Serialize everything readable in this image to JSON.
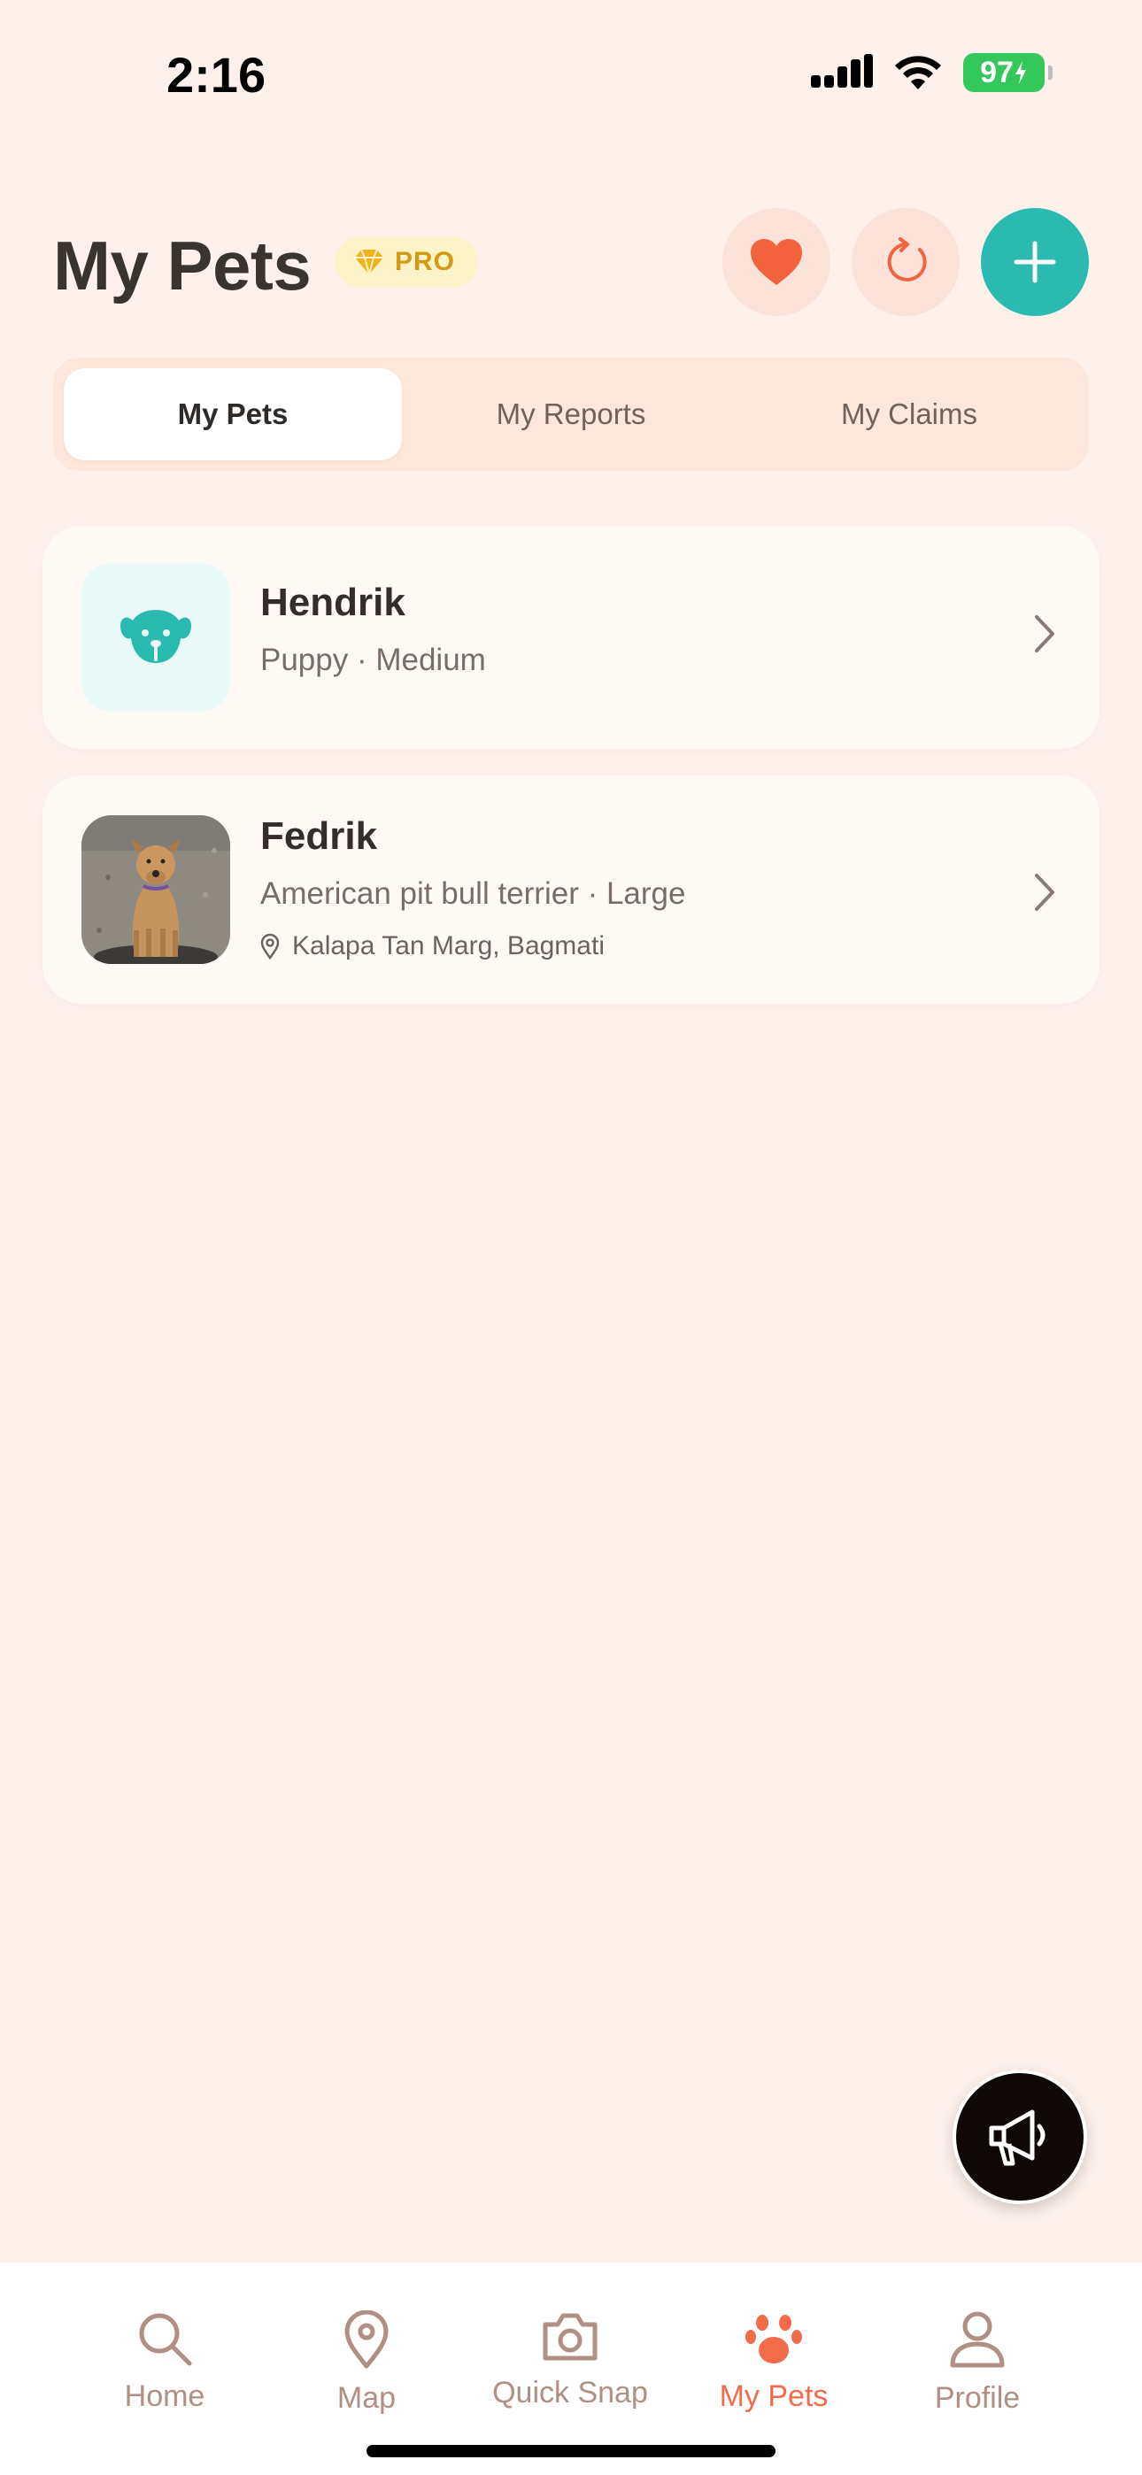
{
  "status_bar": {
    "time": "2:16",
    "battery": "97"
  },
  "header": {
    "title": "My Pets",
    "badge": "PRO"
  },
  "tabs": [
    {
      "label": "My Pets",
      "active": true
    },
    {
      "label": "My Reports",
      "active": false
    },
    {
      "label": "My Claims",
      "active": false
    }
  ],
  "pets": [
    {
      "name": "Hendrik",
      "meta": "Puppy · Medium",
      "thumb_icon": "dog-face-icon"
    },
    {
      "name": "Fedrik",
      "meta": "American pit bull terrier · Large",
      "location": "Kalapa Tan Marg, Bagmati",
      "thumb_icon": "dog-photo"
    }
  ],
  "bottom_nav": [
    {
      "label": "Home",
      "icon": "search-icon",
      "active": false
    },
    {
      "label": "Map",
      "icon": "map-pin-icon",
      "active": false
    },
    {
      "label": "Quick Snap",
      "icon": "camera-icon",
      "active": false
    },
    {
      "label": "My Pets",
      "icon": "paw-icon",
      "active": true
    },
    {
      "label": "Profile",
      "icon": "person-icon",
      "active": false
    }
  ],
  "colors": {
    "accent": "#2BBAAF",
    "active": "#F26B4A",
    "background": "#FEF1EC",
    "pro": "#D49A13"
  }
}
